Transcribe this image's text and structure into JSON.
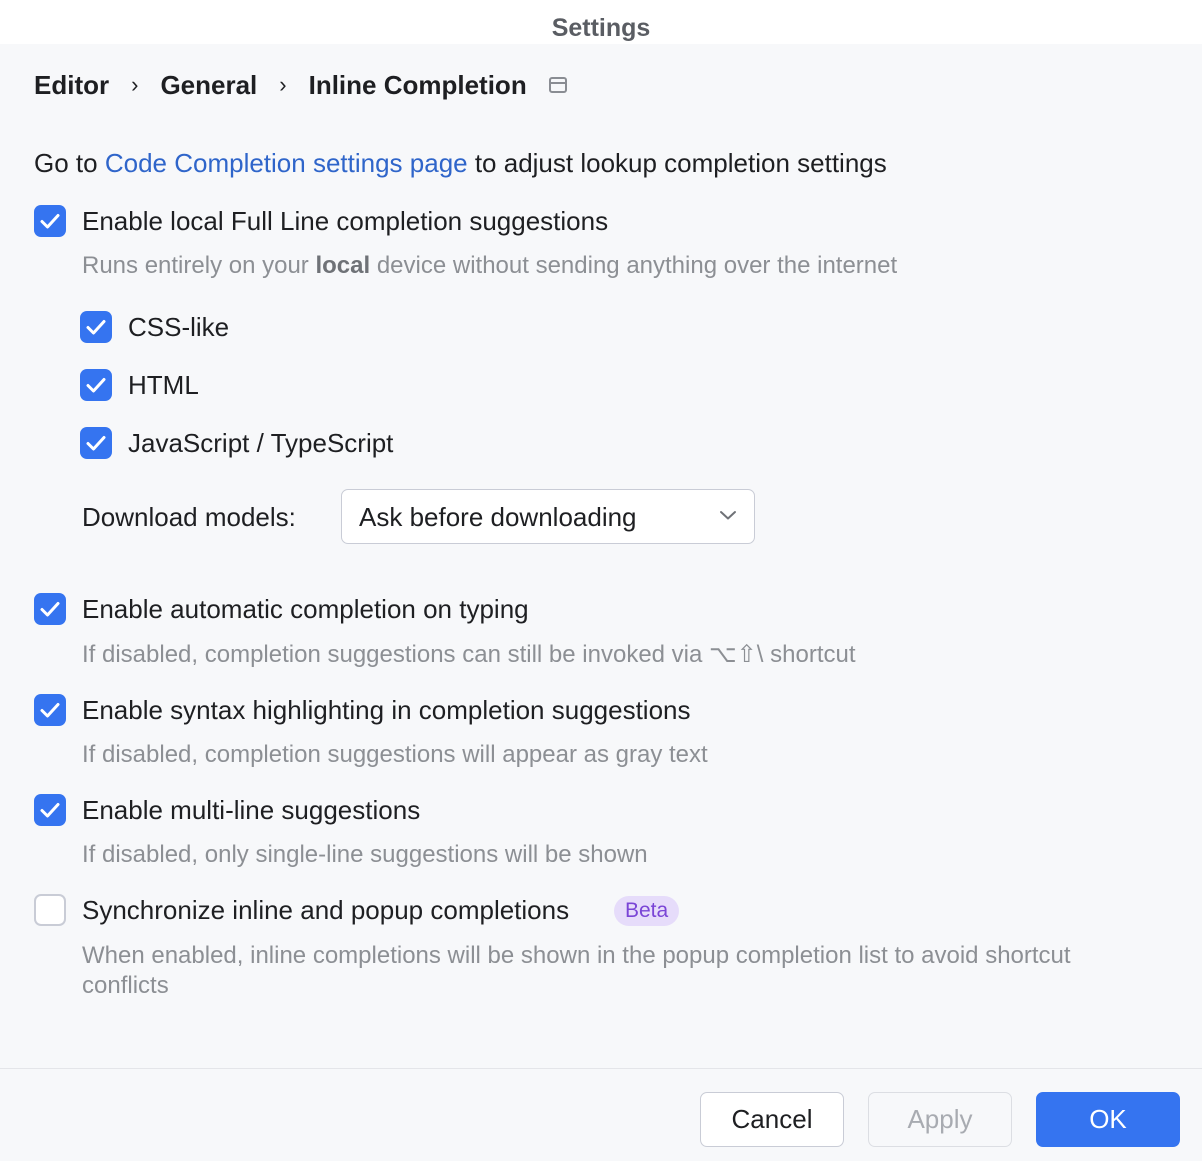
{
  "window": {
    "title": "Settings"
  },
  "breadcrumb": {
    "items": [
      "Editor",
      "General",
      "Inline Completion"
    ],
    "separator": "›"
  },
  "intro": {
    "prefix": "Go to ",
    "link": "Code Completion settings page",
    "suffix": " to adjust lookup completion settings"
  },
  "full_line": {
    "label": "Enable local Full Line completion suggestions",
    "checked": true,
    "hint_prefix": "Runs entirely on your ",
    "hint_bold": "local",
    "hint_suffix": " device without sending anything over the internet",
    "languages": [
      {
        "label": "CSS-like",
        "checked": true
      },
      {
        "label": "HTML",
        "checked": true
      },
      {
        "label": "JavaScript / TypeScript",
        "checked": true
      }
    ],
    "download_label": "Download models:",
    "download_value": "Ask before downloading"
  },
  "options": [
    {
      "label": "Enable automatic completion on typing",
      "checked": true,
      "hint": "If disabled, completion suggestions can still be invoked via ⌥⇧\\ shortcut"
    },
    {
      "label": "Enable syntax highlighting in completion suggestions",
      "checked": true,
      "hint": "If disabled, completion suggestions will appear as gray text"
    },
    {
      "label": "Enable multi-line suggestions",
      "checked": true,
      "hint": "If disabled, only single-line suggestions will be shown"
    },
    {
      "label": "Synchronize inline and popup completions",
      "checked": false,
      "badge": "Beta",
      "hint_line1": "When enabled, inline completions will be shown in the popup completion list to avoid shortcut",
      "hint_line2": "conflicts"
    }
  ],
  "footer": {
    "cancel": "Cancel",
    "apply": "Apply",
    "ok": "OK"
  },
  "colors": {
    "accent": "#3574f0",
    "link": "#2f65ca",
    "hint": "#8c8f94",
    "beta_bg": "#e6dcfa",
    "beta_fg": "#7a45d6"
  }
}
